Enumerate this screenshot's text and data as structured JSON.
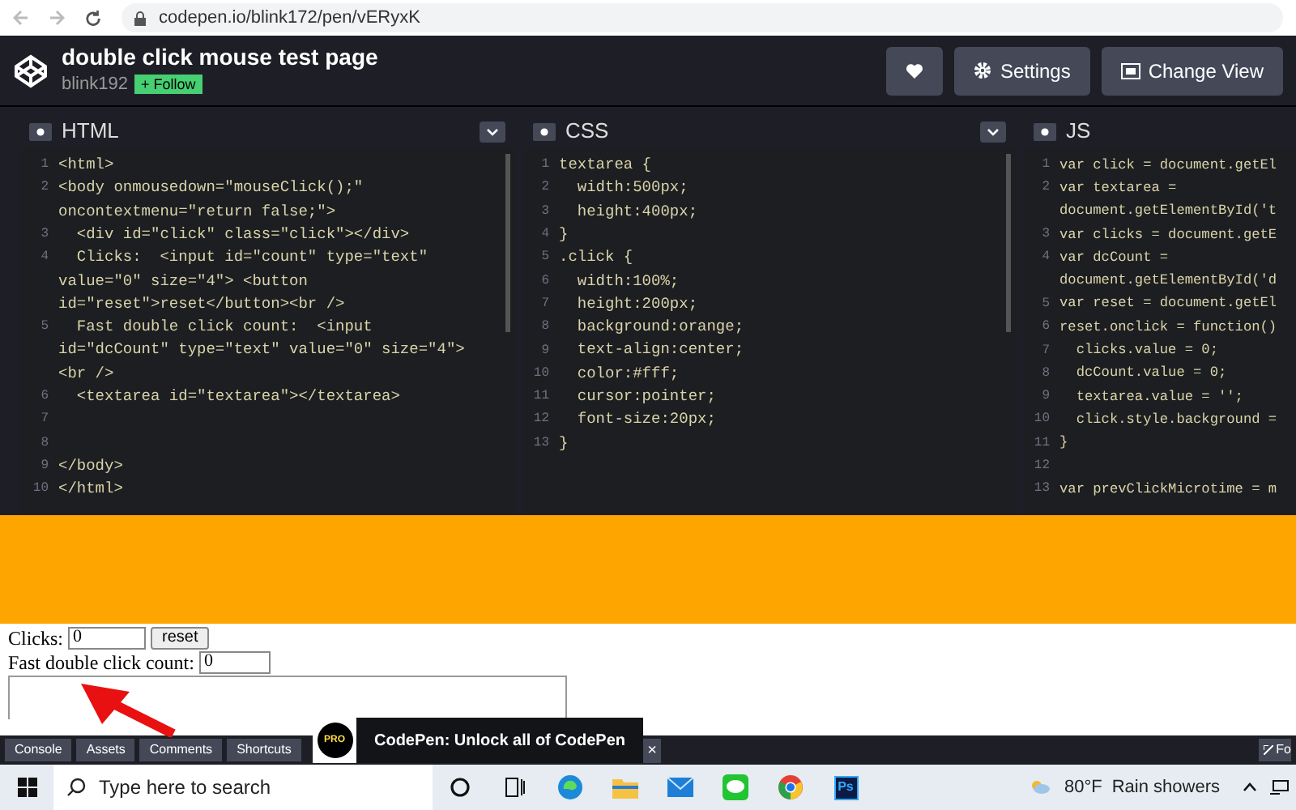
{
  "browser": {
    "url": "codepen.io/blink172/pen/vERyxK"
  },
  "header": {
    "title": "double click mouse test page",
    "author": "blink192",
    "follow": "+ Follow",
    "buttons": [
      {
        "kind": "heart"
      },
      {
        "kind": "settings",
        "label": "Settings"
      },
      {
        "kind": "view",
        "label": "Change View"
      }
    ]
  },
  "editors": [
    {
      "title": "HTML",
      "collapse_button": true,
      "lines": [
        {
          "num": "1",
          "text": "<html>"
        },
        {
          "num": "2",
          "text": "<body onmousedown=\"mouseClick();\""
        },
        {
          "text": "oncontextmenu=\"return false;\">"
        },
        {
          "num": "3",
          "text": "  <div id=\"click\" class=\"click\"></div>"
        },
        {
          "num": "4",
          "text": "  Clicks:  <input id=\"count\" type=\"text\""
        },
        {
          "text": "value=\"0\" size=\"4\"> <button"
        },
        {
          "text": "id=\"reset\">reset</button><br />"
        },
        {
          "num": "5",
          "text": "  Fast double click count:  <input"
        },
        {
          "text": "id=\"dcCount\" type=\"text\" value=\"0\" size=\"4\">"
        },
        {
          "text": "<br />"
        },
        {
          "num": "6",
          "text": "  <textarea id=\"textarea\"></textarea>"
        },
        {
          "num": "7"
        },
        {
          "num": "8"
        },
        {
          "num": "9",
          "text": "</body>"
        },
        {
          "num": "10",
          "text": "</html>"
        }
      ]
    },
    {
      "title": "CSS",
      "collapse_button": true,
      "lines": [
        {
          "num": "1",
          "text": "textarea {"
        },
        {
          "num": "2",
          "text": "  width:500px;"
        },
        {
          "num": "3",
          "text": "  height:400px;"
        },
        {
          "num": "4",
          "text": "}"
        },
        {
          "num": "5",
          "text": ".click {"
        },
        {
          "num": "6",
          "text": "  width:100%;"
        },
        {
          "num": "7",
          "text": "  height:200px;"
        },
        {
          "num": "8",
          "text": "  background:orange;"
        },
        {
          "num": "9",
          "text": "  text-align:center;"
        },
        {
          "num": "10",
          "text": "  color:#fff;"
        },
        {
          "num": "11",
          "text": "  cursor:pointer;"
        },
        {
          "num": "12",
          "text": "  font-size:20px;"
        },
        {
          "num": "13",
          "text": "}"
        }
      ]
    },
    {
      "title": "JS",
      "collapse_button": false,
      "lines": [
        {
          "num": "1",
          "text": "var click = document.getEl"
        },
        {
          "num": "2",
          "text": "var textarea ="
        },
        {
          "text": "document.getElementById('t"
        },
        {
          "num": "3",
          "text": "var clicks = document.getE"
        },
        {
          "num": "4",
          "text": "var dcCount ="
        },
        {
          "text": "document.getElementById('d"
        },
        {
          "num": "5",
          "text": "var reset = document.getEl"
        },
        {
          "num": "6",
          "text": "reset.onclick = function()"
        },
        {
          "num": "7",
          "text": "  clicks.value = 0;"
        },
        {
          "num": "8",
          "text": "  dcCount.value = 0;"
        },
        {
          "num": "9",
          "text": "  textarea.value = '';"
        },
        {
          "num": "10",
          "text": "  click.style.background ="
        },
        {
          "num": "11",
          "text": "}"
        },
        {
          "num": "12"
        },
        {
          "num": "13",
          "text": "var prevClickMicrotime = m"
        }
      ]
    }
  ],
  "preview": {
    "clicks_label": "Clicks:",
    "clicks_value": "0",
    "reset": "reset",
    "fast_label": "Fast double click count:",
    "fast_value": "0"
  },
  "bottom_bar": {
    "tabs": [
      "Console",
      "Assets",
      "Comments",
      "Shortcuts"
    ],
    "promo": {
      "badge": "PRO",
      "text": "CodePen: Unlock all of CodePen",
      "close": "×"
    },
    "right_button": "Fo"
  },
  "taskbar": {
    "search_placeholder": "Type here to search",
    "apps": [
      {
        "kind": "cortana"
      },
      {
        "kind": "taskview"
      },
      {
        "kind": "edge"
      },
      {
        "kind": "folder"
      },
      {
        "kind": "mail"
      },
      {
        "kind": "line"
      },
      {
        "kind": "chrome"
      },
      {
        "kind": "photoshop",
        "label": "Ps"
      }
    ],
    "weather": {
      "temp": "80°F",
      "condition": "Rain showers"
    }
  }
}
